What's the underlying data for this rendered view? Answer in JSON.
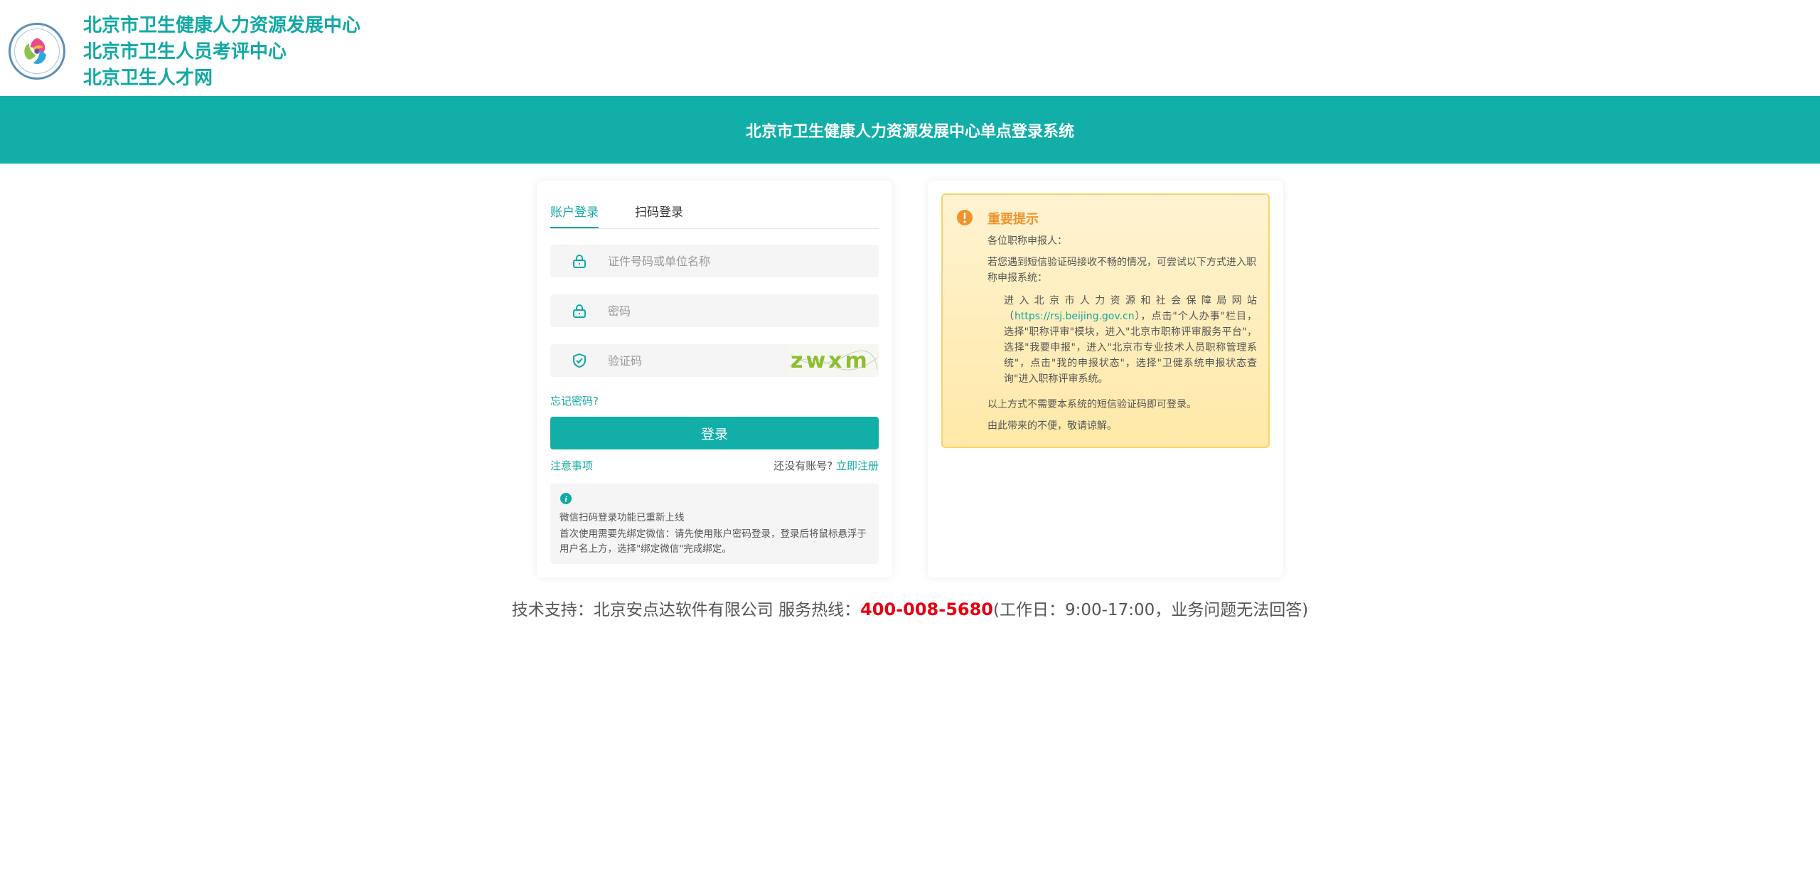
{
  "header": {
    "org_lines": [
      "北京市卫生健康人力资源发展中心",
      "北京市卫生人员考评中心",
      "北京卫生人才网"
    ],
    "banner_title": "北京市卫生健康人力资源发展中心单点登录系统"
  },
  "login": {
    "tabs": [
      {
        "label": "账户登录",
        "active": true
      },
      {
        "label": "扫码登录",
        "active": false
      }
    ],
    "fields": {
      "username_placeholder": "证件号码或单位名称",
      "password_placeholder": "密码",
      "captcha_placeholder": "验证码",
      "captcha_text": "zwxm"
    },
    "forgot_label": "忘记密码?",
    "login_button": "登录",
    "notes_link": "注意事项",
    "no_account_text": "还没有账号?",
    "register_link": "立即注册",
    "info": {
      "line1": "微信扫码登录功能已重新上线",
      "line2": "首次使用需要先绑定微信：请先使用账户密码登录，登录后将鼠标悬浮于用户名上方，选择\"绑定微信\"完成绑定。"
    }
  },
  "notice": {
    "title": "重要提示",
    "greeting": "各位职称申报人：",
    "para1": "若您遇到短信验证码接收不畅的情况，可尝试以下方式进入职称申报系统：",
    "para2_before": "进入北京市人力资源和社会保障局网站（",
    "para2_url": "https://rsj.beijing.gov.cn",
    "para2_after": "），点击\"个人办事\"栏目，选择\"职称评审\"模块，进入\"北京市职称评审服务平台\"，选择\"我要申报\"，进入\"北京市专业技术人员职称管理系统\"，点击\"我的申报状态\"，选择\"卫健系统申报状态查询\"进入职称评审系统。",
    "para3": "以上方式不需要本系统的短信验证码即可登录。",
    "para4": "由此带来的不便，敬请谅解。"
  },
  "footer": {
    "support": "技术支持：北京安点达软件有限公司 服务热线：",
    "hotline": "400-008-5680",
    "hours": "(工作日：9:00-17:00，业务问题无法回答)"
  },
  "colors": {
    "brand": "#12afa8",
    "notice_title": "#f0932b",
    "hotline": "#e60012"
  }
}
